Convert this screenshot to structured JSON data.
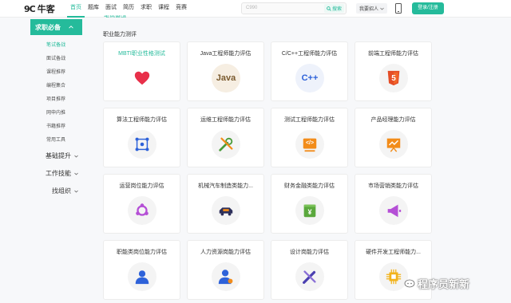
{
  "header": {
    "logo_mark": "9C",
    "logo_name": "牛客",
    "nav": [
      {
        "label": "首页",
        "active": true
      },
      {
        "label": "题库",
        "active": false
      },
      {
        "label": "面试",
        "active": false
      },
      {
        "label": "简历",
        "active": false
      },
      {
        "label": "求职",
        "active": false
      },
      {
        "label": "课程",
        "active": false
      },
      {
        "label": "竞赛",
        "active": false
      }
    ],
    "search_placeholder": "C990",
    "search_button": "搜索",
    "role_select": "我要招人",
    "login_button": "登录/注册"
  },
  "sidebar": {
    "active": "求职必备",
    "sub_items": [
      "笔试备战",
      "面试备战",
      "课程推荐",
      "编程集合",
      "项目推荐",
      "网申内推",
      "书籍推荐",
      "常用工具"
    ],
    "groups": [
      "基础提升",
      "工作技能",
      "找组织"
    ]
  },
  "main": {
    "section_cut": "笔试备战",
    "section_title": "职业能力测评",
    "cards": [
      {
        "title": "MBTI职业性格测试",
        "icon": "heart-icon"
      },
      {
        "title": "Java工程师能力评估",
        "icon": "java-icon",
        "icon_text": "Java"
      },
      {
        "title": "C/C++工程师能力评估",
        "icon": "cpp-icon",
        "icon_text": "C++"
      },
      {
        "title": "前端工程师能力评估",
        "icon": "html5-icon",
        "icon_text": "5"
      },
      {
        "title": "算法工程师能力评估",
        "icon": "algorithm-icon"
      },
      {
        "title": "运维工程师能力评估",
        "icon": "tools-icon"
      },
      {
        "title": "测试工程师能力评估",
        "icon": "code-icon",
        "icon_text": "</>"
      },
      {
        "title": "产品经理能力评估",
        "icon": "presentation-icon"
      },
      {
        "title": "运营岗位能力评估",
        "icon": "operations-icon"
      },
      {
        "title": "机械汽车制造类能力...",
        "icon": "car-icon"
      },
      {
        "title": "财务金融类能力评估",
        "icon": "finance-icon",
        "icon_text": "¥"
      },
      {
        "title": "市场营销类能力评估",
        "icon": "megaphone-icon"
      },
      {
        "title": "职能类岗位能力评估",
        "icon": "person-icon"
      },
      {
        "title": "人力资源岗能力评估",
        "icon": "hr-icon"
      },
      {
        "title": "设计岗能力评估",
        "icon": "design-icon"
      },
      {
        "title": "硬件开发工程师能力...",
        "icon": "chip-icon"
      }
    ]
  },
  "watermark": "程序员新新",
  "colors": {
    "accent": "#25bb9b",
    "heart": "#e8304a",
    "icon_blue": "#2e62d9",
    "icon_orange": "#f28c1a",
    "icon_navy": "#2d2f5a"
  }
}
